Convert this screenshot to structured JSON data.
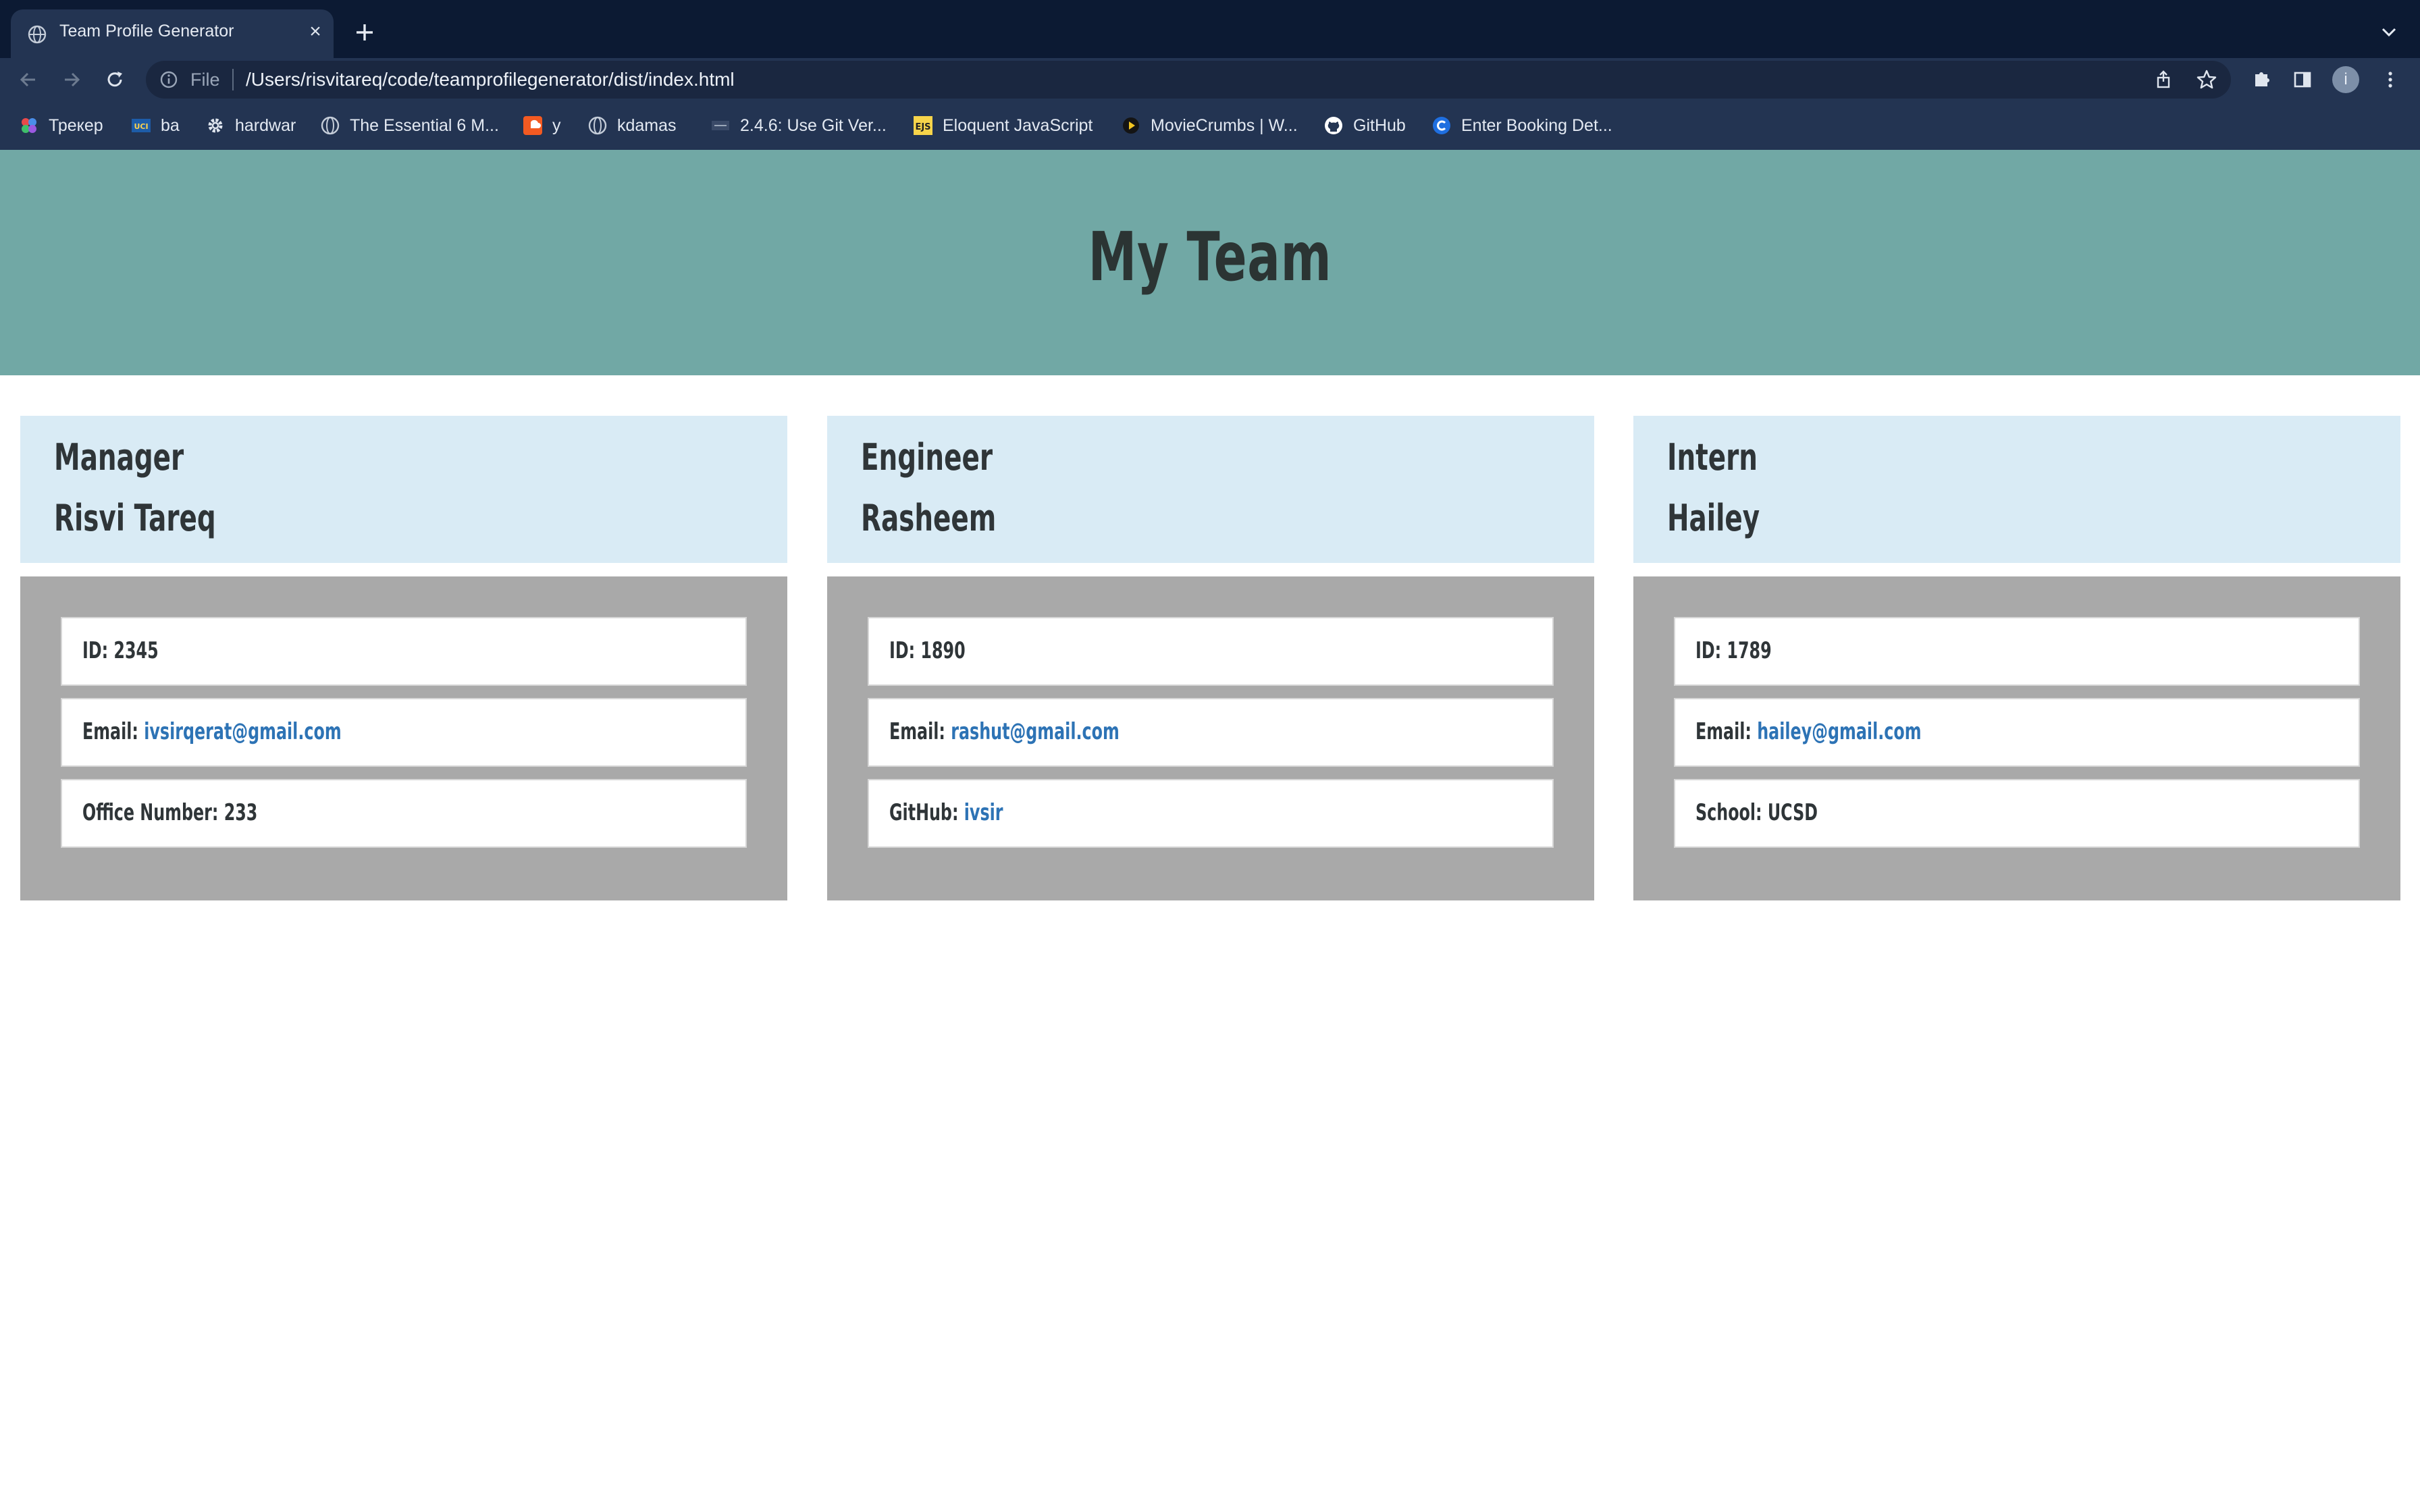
{
  "browser": {
    "tab": {
      "title": "Team Profile Generator"
    },
    "address_bar": {
      "scheme_label": "File",
      "url": "/Users/risvitareq/code/teamprofilegenerator/dist/index.html"
    },
    "bookmarks": [
      {
        "label": "Трекер",
        "icon": "tracker-icon"
      },
      {
        "label": "ba",
        "icon": "uci-icon"
      },
      {
        "label": "hardwar",
        "icon": "gear-icon"
      },
      {
        "label": "The Essential 6 M...",
        "icon": "globe-icon"
      },
      {
        "label": "y",
        "icon": "soundcloud-icon"
      },
      {
        "label": "kdamas",
        "icon": "globe-icon"
      },
      {
        "label": "2.4.6: Use Git Ver...",
        "icon": "page-icon"
      },
      {
        "label": "Eloquent JavaScript",
        "icon": "ejs-icon"
      },
      {
        "label": "MovieCrumbs | W...",
        "icon": "play-icon"
      },
      {
        "label": "GitHub",
        "icon": "github-icon"
      },
      {
        "label": "Enter Booking Det...",
        "icon": "booking-icon"
      }
    ],
    "profile_initial": "i"
  },
  "page": {
    "title": "My Team",
    "cards": [
      {
        "role": "Manager",
        "name": "Risvi Tareq",
        "id_text": "ID: 2345",
        "email_label": "Email: ",
        "email": "ivsirqerat@gmail.com",
        "extra_label": "Office Number: 233",
        "extra_link": ""
      },
      {
        "role": "Engineer",
        "name": "Rasheem",
        "id_text": "ID: 1890",
        "email_label": "Email: ",
        "email": "rashut@gmail.com",
        "extra_label": "GitHub: ",
        "extra_link": "ivsir"
      },
      {
        "role": "Intern",
        "name": "Hailey",
        "id_text": "ID: 1789",
        "email_label": "Email: ",
        "email": "hailey@gmail.com",
        "extra_label": "School: UCSD",
        "extra_link": ""
      }
    ]
  },
  "colors": {
    "hero_bg": "#71a8a5",
    "card_header_bg": "#d9ebf5",
    "card_body_bg": "#a9a9a9",
    "link": "#2d73b5",
    "chrome_dark": "#0c1a33",
    "chrome": "#233452"
  }
}
